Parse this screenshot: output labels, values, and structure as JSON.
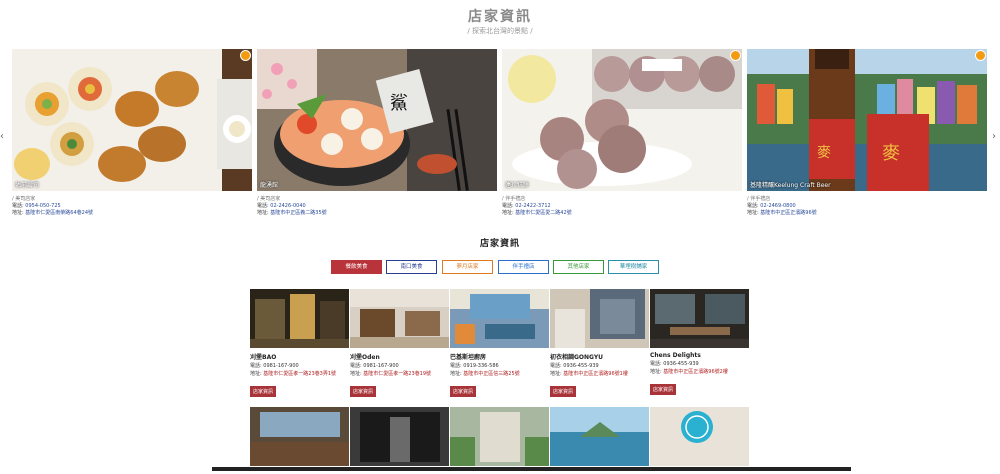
{
  "header": {
    "title": "店家資訊",
    "subtitle": "/ 探索北台灣的景點 /"
  },
  "carousel": {
    "prev_arrow": "‹",
    "next_arrow": "›",
    "cards": [
      {
        "caption": "佑前壽司",
        "category": "/ 美司店家",
        "tel_label": "電話:",
        "tel": "0954-050-725",
        "addr_label": "地址:",
        "addr": "基隆市仁愛區南榮路64巷24號",
        "image": "sushi"
      },
      {
        "caption": "龍湧館",
        "category": "/ 美司店家",
        "tel_label": "電話:",
        "tel": "02-2426-0040",
        "addr_label": "地址:",
        "addr": "基隆市中正區義二路35號",
        "image": "sashimi"
      },
      {
        "caption": "連珍糕餅",
        "category": "/ 伴手禮店",
        "tel_label": "電話:",
        "tel": "02-2422-3712",
        "addr_label": "地址:",
        "addr": "基隆市仁愛區愛二路42號",
        "image": "mochi"
      },
      {
        "caption": "基隆精釀Keelung Craft Beer",
        "category": "/ 伴手禮店",
        "tel_label": "電話:",
        "tel": "02-2469-0800",
        "addr_label": "地址:",
        "addr": "基隆市中正區正濱路96號",
        "image": "beer"
      }
    ]
  },
  "section_title": "店家資訊",
  "filters": [
    {
      "label": "餐飲美食",
      "color": "#b8343a",
      "active": true
    },
    {
      "label": "南口美食",
      "color": "#2a3f8f",
      "active": false
    },
    {
      "label": "夢月店家",
      "color": "#e07a20",
      "active": false
    },
    {
      "label": "伴手禮店",
      "color": "#2a6fd0",
      "active": false
    },
    {
      "label": "其他店家",
      "color": "#3a9a3a",
      "active": false
    },
    {
      "label": "華埋樹鋪家",
      "color": "#2a8fa8",
      "active": false
    }
  ],
  "grid": {
    "tel_label": "電話:",
    "addr_label": "地址:",
    "button_label": "店家資訊",
    "items": [
      {
        "name": "刈堡BAO",
        "tel": "0981-167-900",
        "addr": "基隆市仁愛區孝一路23巷3弄1號"
      },
      {
        "name": "刈堡Oden",
        "tel": "0981-167-900",
        "addr": "基隆市仁愛區孝一路23巷19號"
      },
      {
        "name": "巴基斯坦廚房",
        "tel": "0919-336-586",
        "addr": "基隆市中正區信三路25號"
      },
      {
        "name": "初衣相調GONGYU",
        "tel": "0936-455-939",
        "addr": "基隆市中正區正濱路96號1樓"
      },
      {
        "name": "Chens Delights",
        "tel": "0936-455-939",
        "addr": "基隆市中正區正濱路96號2樓"
      }
    ]
  }
}
